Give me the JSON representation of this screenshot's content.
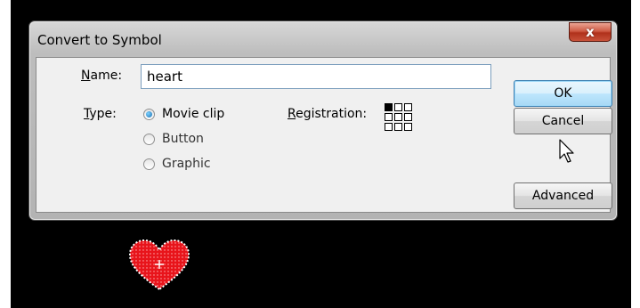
{
  "window": {
    "title": "Convert to Symbol",
    "close_symbol": "x"
  },
  "form": {
    "name_label": "Name:",
    "name_value": "heart",
    "type_label": "Type:",
    "type_options": [
      {
        "label": "Movie clip",
        "selected": true
      },
      {
        "label": "Button",
        "selected": false
      },
      {
        "label": "Graphic",
        "selected": false
      }
    ],
    "registration_label": "Registration:",
    "registration_selected": "top-left"
  },
  "buttons": {
    "ok": "OK",
    "cancel": "Cancel",
    "advanced": "Advanced"
  },
  "icons": {
    "registration": "registration-grid-icon",
    "cursor": "mouse-pointer-icon",
    "heart": "heart-symbol-icon"
  },
  "colors": {
    "stage_background": "#000000",
    "heart_fill": "#e8141b",
    "default_button": "#bee6fd"
  }
}
